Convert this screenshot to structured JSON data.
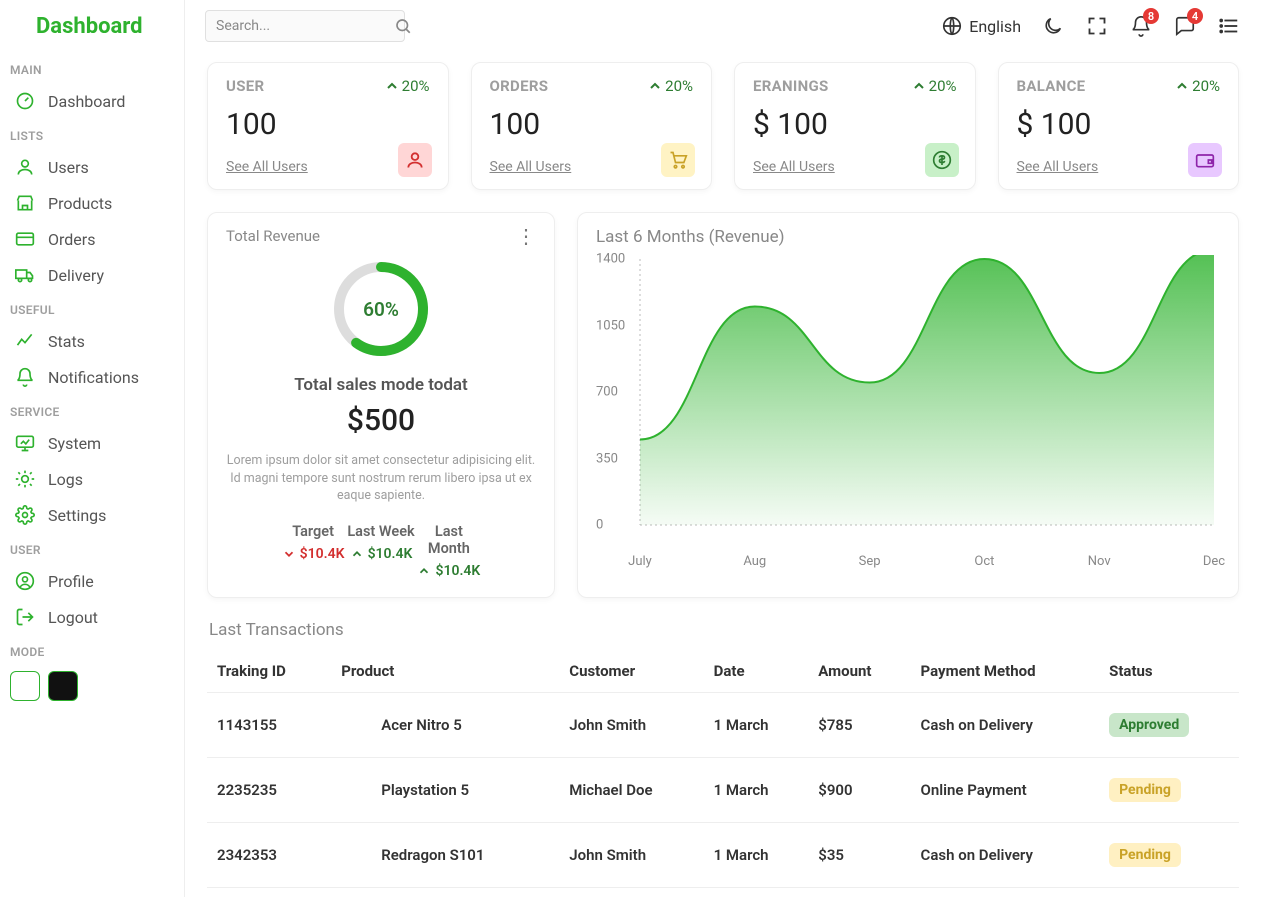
{
  "logo": "Dashboard",
  "search": {
    "placeholder": "Search..."
  },
  "topbar": {
    "language": "English",
    "notif_badge": "8",
    "msg_badge": "4"
  },
  "sidebar": {
    "sections": [
      {
        "label": "MAIN",
        "items": [
          {
            "label": "Dashboard",
            "icon": "dashboard"
          }
        ]
      },
      {
        "label": "LISTS",
        "items": [
          {
            "label": "Users",
            "icon": "user"
          },
          {
            "label": "Products",
            "icon": "store"
          },
          {
            "label": "Orders",
            "icon": "card"
          },
          {
            "label": "Delivery",
            "icon": "truck"
          }
        ]
      },
      {
        "label": "USEFUL",
        "items": [
          {
            "label": "Stats",
            "icon": "stats"
          },
          {
            "label": "Notifications",
            "icon": "bell"
          }
        ]
      },
      {
        "label": "SERVICE",
        "items": [
          {
            "label": "System",
            "icon": "monitor"
          },
          {
            "label": "Logs",
            "icon": "psych"
          },
          {
            "label": "Settings",
            "icon": "gear"
          }
        ]
      },
      {
        "label": "USER",
        "items": [
          {
            "label": "Profile",
            "icon": "profile"
          },
          {
            "label": "Logout",
            "icon": "logout"
          }
        ]
      },
      {
        "label": "MODE",
        "items": []
      }
    ]
  },
  "cards": [
    {
      "title": "USER",
      "pct": "20%",
      "value": "100",
      "link": "See All Users",
      "icon": "user"
    },
    {
      "title": "ORDERS",
      "pct": "20%",
      "value": "100",
      "link": "See All Users",
      "icon": "cart"
    },
    {
      "title": "ERANINGS",
      "pct": "20%",
      "value": "$ 100",
      "link": "See All Users",
      "icon": "dollar"
    },
    {
      "title": "BALANCE",
      "pct": "20%",
      "value": "$ 100",
      "link": "See All Users",
      "icon": "wallet"
    }
  ],
  "revenue": {
    "title": "Total Revenue",
    "ring_pct": 60,
    "ring_label": "60%",
    "subtitle": "Total sales mode todat",
    "amount": "$500",
    "desc": "Lorem ipsum dolor sit amet consectetur adipisicing elit. Id magni tempore sunt nostrum rerum libero ipsa ut ex eaque sapiente.",
    "cols": [
      {
        "label": "Target",
        "value": "$10.4K",
        "dir": "down"
      },
      {
        "label": "Last Week",
        "value": "$10.4K",
        "dir": "up"
      },
      {
        "label": "Last Month",
        "value": "$10.4K",
        "dir": "up"
      }
    ]
  },
  "chart_data": {
    "type": "area",
    "title": "Last 6 Months (Revenue)",
    "xlabel": "",
    "ylabel": "",
    "ylim": [
      0,
      1400
    ],
    "y_ticks": [
      0,
      350,
      700,
      1050,
      1400
    ],
    "categories": [
      "July",
      "Aug",
      "Sep",
      "Oct",
      "Nov",
      "Dec"
    ],
    "values": [
      450,
      1150,
      750,
      1400,
      800,
      1450
    ]
  },
  "transactions": {
    "title": "Last Transactions",
    "columns": [
      "Traking ID",
      "Product",
      "Customer",
      "Date",
      "Amount",
      "Payment Method",
      "Status"
    ],
    "rows": [
      {
        "id": "1143155",
        "product": "Acer Nitro 5",
        "customer": "John Smith",
        "date": "1 March",
        "amount": "$785",
        "method": "Cash on Delivery",
        "status": "Approved"
      },
      {
        "id": "2235235",
        "product": "Playstation 5",
        "customer": "Michael Doe",
        "date": "1 March",
        "amount": "$900",
        "method": "Online Payment",
        "status": "Pending"
      },
      {
        "id": "2342353",
        "product": "Redragon S101",
        "customer": "John Smith",
        "date": "1 March",
        "amount": "$35",
        "method": "Cash on Delivery",
        "status": "Pending"
      }
    ]
  }
}
